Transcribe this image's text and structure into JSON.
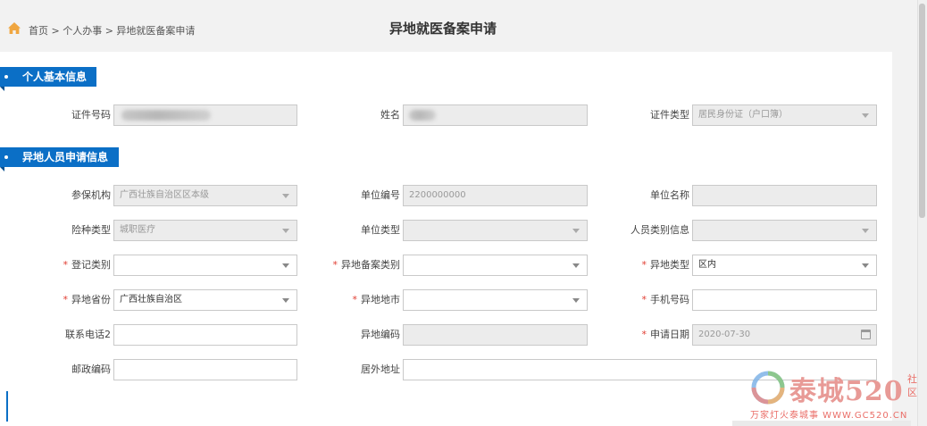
{
  "breadcrumb": {
    "text": "首页 > 个人办事 > 异地就医备案申请"
  },
  "page_title": "异地就医备案申请",
  "sections": {
    "basic": "个人基本信息",
    "application": "异地人员申请信息"
  },
  "labels": {
    "id_number": "证件号码",
    "name": "姓名",
    "id_type": "证件类型",
    "insurance_agency": "参保机构",
    "unit_code": "单位编号",
    "unit_name": "单位名称",
    "insurance_type": "险种类型",
    "unit_type": "单位类型",
    "person_category": "人员类别信息",
    "register_category": "登记类别",
    "remote_filing_category": "异地备案类别",
    "remote_type": "异地类型",
    "remote_province": "异地省份",
    "remote_city": "异地地市",
    "mobile": "手机号码",
    "phone2": "联系电话2",
    "remote_code": "异地编码",
    "apply_date": "申请日期",
    "postcode": "邮政编码",
    "overseas_address": "居外地址"
  },
  "required_mark": "*",
  "values": {
    "id_type": "居民身份证（户口簿）",
    "insurance_agency": "广西壮族自治区区本级",
    "unit_code": "2200000000",
    "insurance_type": "城职医疗",
    "remote_type": "区内",
    "remote_province": "广西壮族自治区",
    "apply_date": "2020-07-30"
  },
  "watermark": {
    "main": "泰城520",
    "side": "社区",
    "sub": "万家灯火泰城事 WWW.GC520.CN"
  },
  "colors": {
    "accent": "#0b6fc6",
    "required": "#e03c31"
  }
}
